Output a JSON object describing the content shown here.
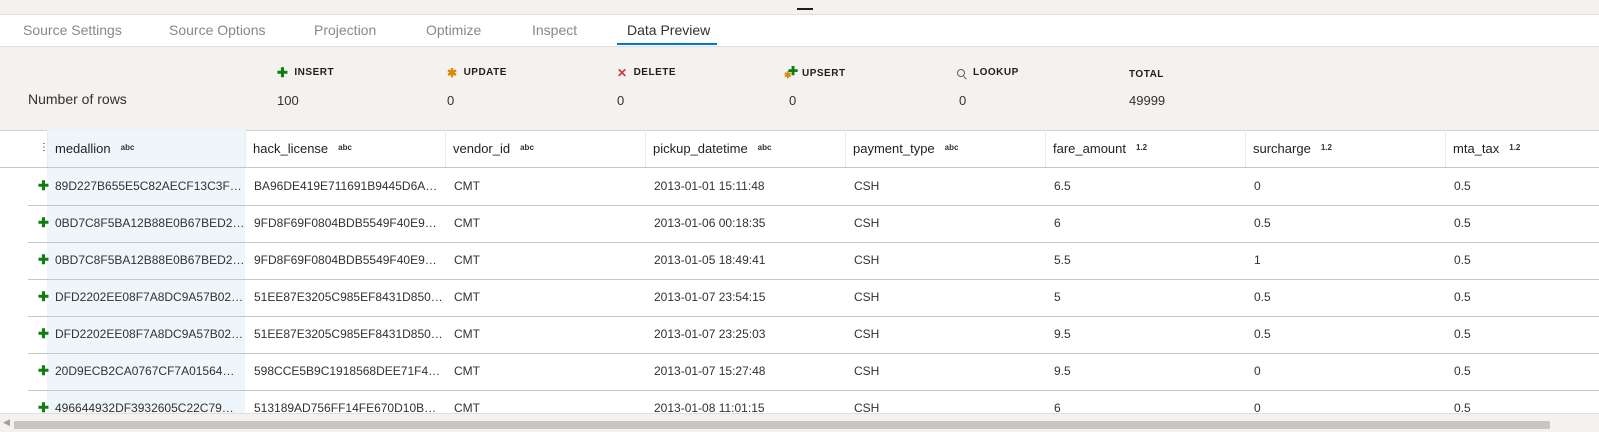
{
  "tabs": [
    {
      "label": "Source Settings"
    },
    {
      "label": "Source Options"
    },
    {
      "label": "Projection"
    },
    {
      "label": "Optimize"
    },
    {
      "label": "Inspect"
    },
    {
      "label": "Data Preview"
    }
  ],
  "active_tab": "Data Preview",
  "summary": {
    "row_label": "Number of rows",
    "stats": [
      {
        "label": "INSERT",
        "value": "100",
        "icon": "insert-plus-icon"
      },
      {
        "label": "UPDATE",
        "value": "0",
        "icon": "update-star-icon"
      },
      {
        "label": "DELETE",
        "value": "0",
        "icon": "delete-x-icon"
      },
      {
        "label": "UPSERT",
        "value": "0",
        "icon": "upsert-icon"
      },
      {
        "label": "LOOKUP",
        "value": "0",
        "icon": "lookup-search-icon"
      },
      {
        "label": "TOTAL",
        "value": "49999"
      }
    ]
  },
  "grid": {
    "columns": [
      {
        "name": "medallion",
        "type": "abc"
      },
      {
        "name": "hack_license",
        "type": "abc"
      },
      {
        "name": "vendor_id",
        "type": "abc"
      },
      {
        "name": "pickup_datetime",
        "type": "abc"
      },
      {
        "name": "payment_type",
        "type": "abc"
      },
      {
        "name": "fare_amount",
        "type": "1.2"
      },
      {
        "name": "surcharge",
        "type": "1.2"
      },
      {
        "name": "mta_tax",
        "type": "1.2"
      }
    ],
    "row_op_icon": "insert-plus-icon",
    "rows": [
      [
        "89D227B655E5C82AECF13C3F…",
        "BA96DE419E711691B9445D6A…",
        "CMT",
        "2013-01-01 15:11:48",
        "CSH",
        "6.5",
        "0",
        "0.5"
      ],
      [
        "0BD7C8F5BA12B88E0B67BED2…",
        "9FD8F69F0804BDB5549F40E9…",
        "CMT",
        "2013-01-06 00:18:35",
        "CSH",
        "6",
        "0.5",
        "0.5"
      ],
      [
        "0BD7C8F5BA12B88E0B67BED2…",
        "9FD8F69F0804BDB5549F40E9…",
        "CMT",
        "2013-01-05 18:49:41",
        "CSH",
        "5.5",
        "1",
        "0.5"
      ],
      [
        "DFD2202EE08F7A8DC9A57B02…",
        "51EE87E3205C985EF8431D850…",
        "CMT",
        "2013-01-07 23:54:15",
        "CSH",
        "5",
        "0.5",
        "0.5"
      ],
      [
        "DFD2202EE08F7A8DC9A57B02…",
        "51EE87E3205C985EF8431D850…",
        "CMT",
        "2013-01-07 23:25:03",
        "CSH",
        "9.5",
        "0.5",
        "0.5"
      ],
      [
        "20D9ECB2CA0767CF7A01564…",
        "598CCE5B9C1918568DEE71F4…",
        "CMT",
        "2013-01-07 15:27:48",
        "CSH",
        "9.5",
        "0",
        "0.5"
      ],
      [
        "496644932DF3932605C22C79…",
        "513189AD756FF14FE670D10B…",
        "CMT",
        "2013-01-08 11:01:15",
        "CSH",
        "6",
        "0",
        "0.5"
      ]
    ]
  },
  "colors": {
    "accent": "#0078d4",
    "insert": "#107c10",
    "update": "#d98b00",
    "delete": "#d13438"
  }
}
